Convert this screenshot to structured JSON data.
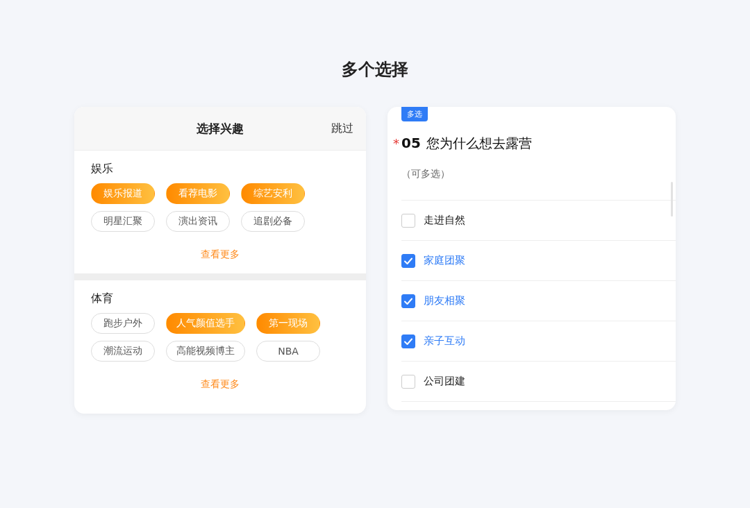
{
  "heading": "多个选择",
  "interest_card": {
    "title": "选择兴趣",
    "skip": "跳过",
    "sections": [
      {
        "label": "娱乐",
        "more": "查看更多",
        "tags": [
          {
            "label": "娱乐报道",
            "selected": true
          },
          {
            "label": "看荐电影",
            "selected": true
          },
          {
            "label": "综艺安利",
            "selected": true
          },
          {
            "label": "明星汇聚",
            "selected": false
          },
          {
            "label": "演出资讯",
            "selected": false
          },
          {
            "label": "追剧必备",
            "selected": false
          }
        ]
      },
      {
        "label": "体育",
        "more": "查看更多",
        "tags": [
          {
            "label": "跑步户外",
            "selected": false
          },
          {
            "label": "人气颜值选手",
            "selected": true
          },
          {
            "label": "第一现场",
            "selected": true
          },
          {
            "label": "潮流运动",
            "selected": false
          },
          {
            "label": "高能视频博主",
            "selected": false
          },
          {
            "label": "NBA",
            "selected": false
          }
        ]
      }
    ]
  },
  "question": {
    "badge": "多选",
    "required_mark": "*",
    "number": "05",
    "title": "您为什么想去露营",
    "hint": "（可多选）",
    "options": [
      {
        "label": "走进自然",
        "checked": false
      },
      {
        "label": "家庭团聚",
        "checked": true
      },
      {
        "label": "朋友相聚",
        "checked": true
      },
      {
        "label": "亲子互动",
        "checked": true
      },
      {
        "label": "公司团建",
        "checked": false
      }
    ]
  }
}
